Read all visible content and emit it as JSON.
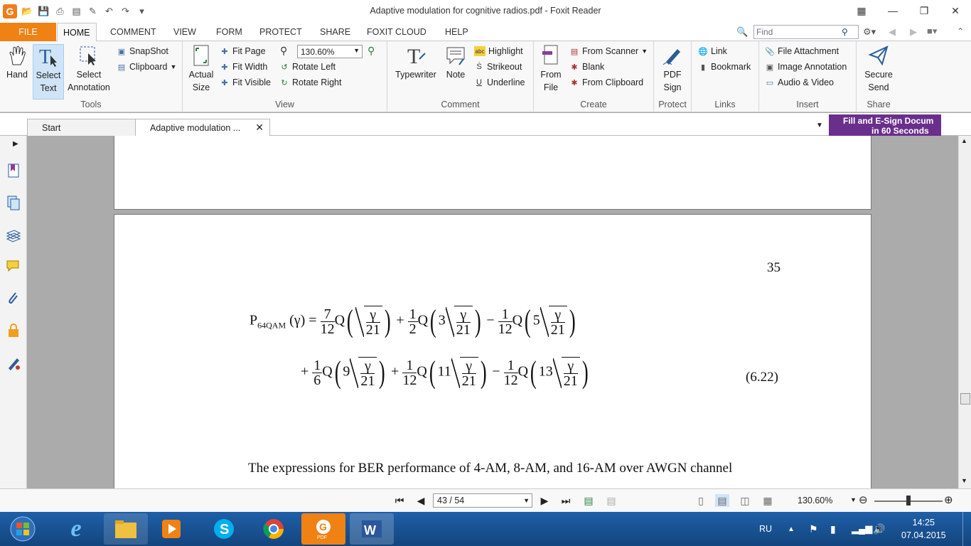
{
  "window": {
    "title": "Adaptive modulation for cognitive radios.pdf - Foxit Reader"
  },
  "ribbon_tabs": [
    "FILE",
    "HOME",
    "COMMENT",
    "VIEW",
    "FORM",
    "PROTECT",
    "SHARE",
    "FOXIT CLOUD",
    "HELP"
  ],
  "find": {
    "placeholder": "Find"
  },
  "tools": {
    "hand": "Hand",
    "select_text_1": "Select",
    "select_text_2": "Text",
    "select_annot_1": "Select",
    "select_annot_2": "Annotation",
    "snapshot": "SnapShot",
    "clipboard": "Clipboard",
    "group": "Tools"
  },
  "view": {
    "actual_1": "Actual",
    "actual_2": "Size",
    "fit_page": "Fit Page",
    "fit_width": "Fit Width",
    "fit_visible": "Fit Visible",
    "zoom": "130.60%",
    "rotate_left": "Rotate Left",
    "rotate_right": "Rotate Right",
    "group": "View"
  },
  "comment": {
    "typewriter": "Typewriter",
    "note": "Note",
    "highlight": "Highlight",
    "strikeout": "Strikeout",
    "underline": "Underline",
    "group": "Comment"
  },
  "create": {
    "from_1": "From",
    "from_2": "File",
    "from_scanner": "From Scanner",
    "blank": "Blank",
    "from_clipboard": "From Clipboard",
    "group": "Create"
  },
  "protect": {
    "pdf_1": "PDF",
    "pdf_2": "Sign",
    "group": "Protect"
  },
  "links": {
    "link": "Link",
    "bookmark": "Bookmark",
    "group": "Links"
  },
  "insert": {
    "file_attachment": "File Attachment",
    "image_annotation": "Image Annotation",
    "audio_video": "Audio & Video",
    "group": "Insert"
  },
  "share": {
    "secure_1": "Secure",
    "secure_2": "Send",
    "group": "Share"
  },
  "doc_tabs": {
    "start": "Start",
    "current": "Adaptive modulation ..."
  },
  "ad": {
    "line1": "Fill and E-Sign Docum",
    "line2": "in 60 Seconds"
  },
  "document": {
    "page_number": "35",
    "eq_label": "(6.22)",
    "body_text": "The expressions for BER performance of 4-AM, 8-AM, and 16-AM over AWGN channel",
    "eq": {
      "lhs": "P",
      "lhs_sub": "64QAM",
      "lhs_arg": "(γ) =",
      "f1n": "7",
      "f1d": "12",
      "f2n": "1",
      "f2d": "2",
      "f3n": "1",
      "f3d": "12",
      "f4n": "1",
      "f4d": "6",
      "f5n": "1",
      "f5d": "12",
      "f6n": "1",
      "f6d": "12",
      "g": "γ",
      "r": "21",
      "q": "Q",
      "c2": "3",
      "c3": "5",
      "c4": "9",
      "c5": "11",
      "c6": "13",
      "plus": "+",
      "minus": "−"
    }
  },
  "status": {
    "page": "43 / 54",
    "zoom": "130.60%"
  },
  "taskbar": {
    "lang": "RU",
    "time": "14:25",
    "date": "07.04.2015"
  }
}
